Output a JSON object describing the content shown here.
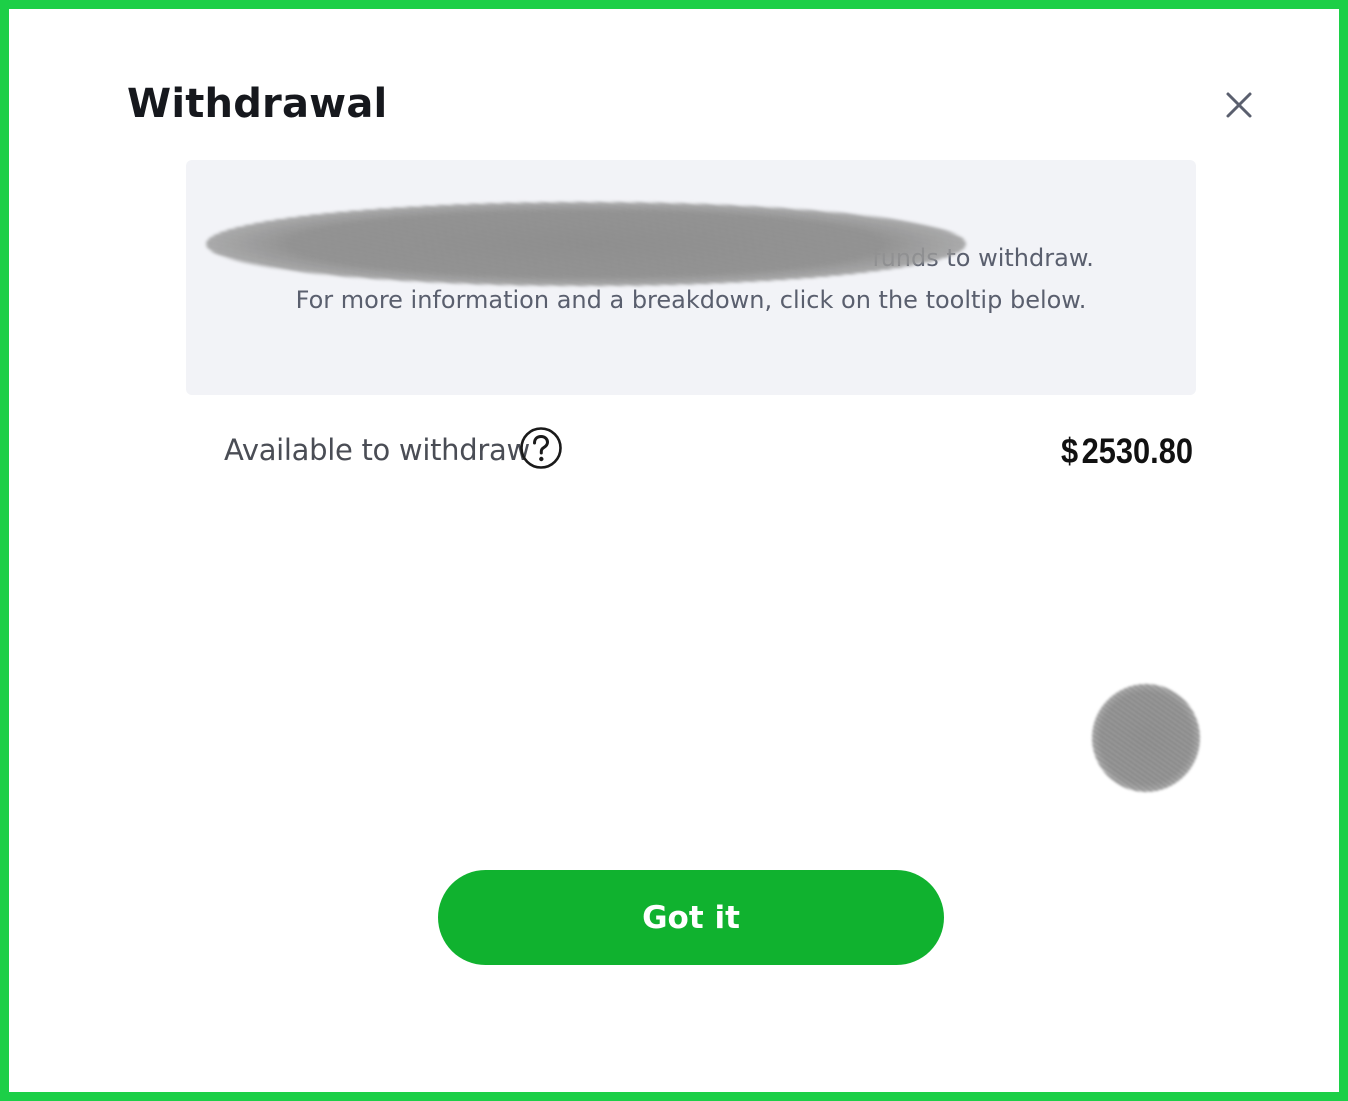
{
  "dialog": {
    "title": "Withdrawal",
    "close_icon": "close-icon"
  },
  "info": {
    "line1": "funds to withdraw.",
    "line2": "For more information and a breakdown, click on the tooltip below."
  },
  "balance": {
    "label": "Available to withdraw",
    "help_icon": "question-circle-icon",
    "currency": "$",
    "amount": "2530.80"
  },
  "actions": {
    "confirm_label": "Got it"
  },
  "colors": {
    "frame": "#1ccf47",
    "button": "#10b22f",
    "info_bg": "#f2f3f7"
  }
}
